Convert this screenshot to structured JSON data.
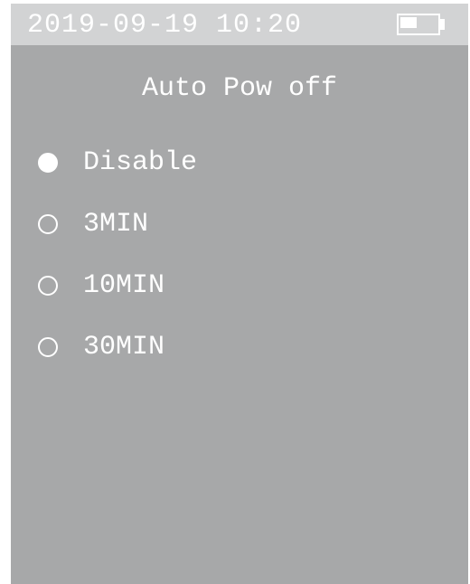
{
  "status_bar": {
    "datetime": "2019-09-19 10:20",
    "battery_level": 0.5
  },
  "menu": {
    "title": "Auto Pow off",
    "options": [
      {
        "label": "Disable",
        "selected": true
      },
      {
        "label": "3MIN",
        "selected": false
      },
      {
        "label": "10MIN",
        "selected": false
      },
      {
        "label": "30MIN",
        "selected": false
      }
    ]
  },
  "colors": {
    "background": "#a7a8a9",
    "status_bar": "#d2d3d4",
    "text": "#ffffff"
  }
}
